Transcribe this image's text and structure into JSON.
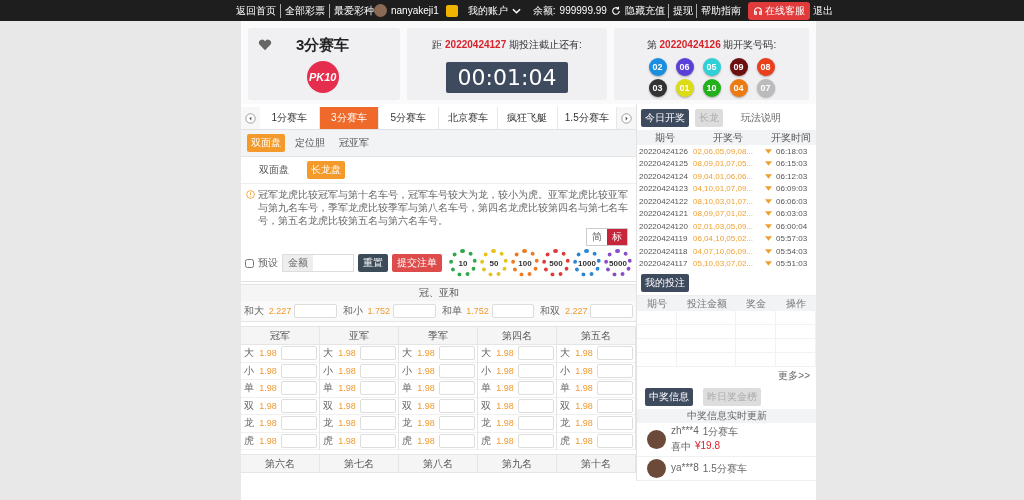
{
  "top_bar": {
    "links": [
      "返回首页",
      "全部彩票",
      "最爱彩种"
    ],
    "username": "nanyakeji1",
    "account_menu": "我的账户",
    "balance_label": "余额:",
    "balance": "999999.99",
    "hide": "隐藏",
    "actions": [
      "充值",
      "提现",
      "帮助指南"
    ],
    "service": "在线客服",
    "logout": "退出"
  },
  "game": {
    "title": "3分赛车",
    "logo_text": "PK10"
  },
  "countdown": {
    "prefix": "距",
    "issue": "20220424127",
    "suffix": "期投注截止还有:",
    "time": "00:01:04"
  },
  "last_draw": {
    "prefix": "第",
    "issue": "20220424126",
    "suffix": "期开奖号码:",
    "balls": [
      {
        "number": "02",
        "color": "#1a8fe0"
      },
      {
        "number": "06",
        "color": "#5b3fd9"
      },
      {
        "number": "05",
        "color": "#30d0d6"
      },
      {
        "number": "09",
        "color": "#6b0f0f"
      },
      {
        "number": "08",
        "color": "#e8401c"
      },
      {
        "number": "03",
        "color": "#333333"
      },
      {
        "number": "01",
        "color": "#dcdc14"
      },
      {
        "number": "10",
        "color": "#22b01c"
      },
      {
        "number": "04",
        "color": "#ee7a12"
      },
      {
        "number": "07",
        "color": "#bbbbbb"
      }
    ]
  },
  "game_tabs": [
    {
      "label": "1分赛车",
      "selected": false
    },
    {
      "label": "3分赛车",
      "selected": true
    },
    {
      "label": "5分赛车",
      "selected": false
    },
    {
      "label": "北京赛车",
      "selected": false
    },
    {
      "label": "疯狂飞艇",
      "selected": false
    },
    {
      "label": "1.5分赛车",
      "selected": false
    }
  ],
  "play_tabs": [
    {
      "label": "双面盘",
      "selected": true
    },
    {
      "label": "定位胆",
      "selected": false
    },
    {
      "label": "冠亚军",
      "selected": false
    }
  ],
  "mode_tabs": [
    {
      "label": "双面盘",
      "selected": false
    },
    {
      "label": "长龙盘",
      "selected": true
    }
  ],
  "notice": "冠军龙虎比较冠军与第十名车号，冠军车号较大为龙，较小为虎。亚军龙虎比较亚军与第九名车号，季军龙虎比较季军与第八名车号，第四名龙虎比较第四名与第七名车号，第五名龙虎比较第五名与第六名车号。",
  "view_toggle": [
    {
      "label": "简",
      "selected": false
    },
    {
      "label": "标",
      "selected": true
    }
  ],
  "bet_bar": {
    "preset_label": "预设",
    "preset_checked": false,
    "amount_label": "金额",
    "reset": "重置",
    "submit": "提交注单",
    "chips": [
      {
        "value": "10",
        "color": "#2ea84a"
      },
      {
        "value": "50",
        "color": "#e6c21a"
      },
      {
        "value": "100",
        "color": "#ee7a22"
      },
      {
        "value": "500",
        "color": "#e23a3a"
      },
      {
        "value": "1000",
        "color": "#2b86d6"
      },
      {
        "value": "5000",
        "color": "#8a4cc9"
      }
    ]
  },
  "sum_section": {
    "title": "冠、亚和",
    "options": [
      {
        "label": "和大",
        "odds": "2.227"
      },
      {
        "label": "和小",
        "odds": "1.752"
      },
      {
        "label": "和单",
        "odds": "1.752"
      },
      {
        "label": "和双",
        "odds": "2.227"
      }
    ]
  },
  "positions": [
    {
      "title": "冠军",
      "options": [
        {
          "label": "大",
          "odds": "1.98"
        },
        {
          "label": "小",
          "odds": "1.98"
        },
        {
          "label": "单",
          "odds": "1.98"
        },
        {
          "label": "双",
          "odds": "1.98"
        },
        {
          "label": "龙",
          "odds": "1.98"
        },
        {
          "label": "虎",
          "odds": "1.98"
        }
      ]
    },
    {
      "title": "亚军",
      "options": [
        {
          "label": "大",
          "odds": "1.98"
        },
        {
          "label": "小",
          "odds": "1.98"
        },
        {
          "label": "单",
          "odds": "1.98"
        },
        {
          "label": "双",
          "odds": "1.98"
        },
        {
          "label": "龙",
          "odds": "1.98"
        },
        {
          "label": "虎",
          "odds": "1.98"
        }
      ]
    },
    {
      "title": "季军",
      "options": [
        {
          "label": "大",
          "odds": "1.98"
        },
        {
          "label": "小",
          "odds": "1.98"
        },
        {
          "label": "单",
          "odds": "1.98"
        },
        {
          "label": "双",
          "odds": "1.98"
        },
        {
          "label": "龙",
          "odds": "1.98"
        },
        {
          "label": "虎",
          "odds": "1.98"
        }
      ]
    },
    {
      "title": "第四名",
      "options": [
        {
          "label": "大",
          "odds": "1.98"
        },
        {
          "label": "小",
          "odds": "1.98"
        },
        {
          "label": "单",
          "odds": "1.98"
        },
        {
          "label": "双",
          "odds": "1.98"
        },
        {
          "label": "龙",
          "odds": "1.98"
        },
        {
          "label": "虎",
          "odds": "1.98"
        }
      ]
    },
    {
      "title": "第五名",
      "options": [
        {
          "label": "大",
          "odds": "1.98"
        },
        {
          "label": "小",
          "odds": "1.98"
        },
        {
          "label": "单",
          "odds": "1.98"
        },
        {
          "label": "双",
          "odds": "1.98"
        },
        {
          "label": "龙",
          "odds": "1.98"
        },
        {
          "label": "虎",
          "odds": "1.98"
        }
      ]
    }
  ],
  "more_positions": [
    "第六名",
    "第七名",
    "第八名",
    "第九名",
    "第十名"
  ],
  "right_panel": {
    "tabs": [
      {
        "label": "今日开奖",
        "selected": true
      },
      {
        "label": "长龙",
        "selected": false
      }
    ],
    "rules_link": "玩法说明",
    "draw_columns": [
      "期号",
      "开奖号",
      "开奖时间"
    ],
    "draws": [
      {
        "issue": "20220424126",
        "numbers": "02,06,05,09,08...",
        "time": "06:18:03"
      },
      {
        "issue": "20220424125",
        "numbers": "08,09,01,07,05...",
        "time": "06:15:03"
      },
      {
        "issue": "20220424124",
        "numbers": "09,04,01,06,06...",
        "time": "06:12:03"
      },
      {
        "issue": "20220424123",
        "numbers": "04,10,01,07,09...",
        "time": "06:09:03"
      },
      {
        "issue": "20220424122",
        "numbers": "08,10,03,01,07...",
        "time": "06:06:03"
      },
      {
        "issue": "20220424121",
        "numbers": "08,09,07,01,02...",
        "time": "06:03:03"
      },
      {
        "issue": "20220424120",
        "numbers": "02,01,03,05,09...",
        "time": "06:00:04"
      },
      {
        "issue": "20220424119",
        "numbers": "06,04,10,05,02...",
        "time": "05:57:03"
      },
      {
        "issue": "20220424118",
        "numbers": "04,07,10,06,09...",
        "time": "05:54:03"
      },
      {
        "issue": "20220424117",
        "numbers": "05,10,03,07,02...",
        "time": "05:51:03"
      }
    ],
    "my_bets_button": "我的投注",
    "bet_columns": [
      "期号",
      "投注金额",
      "奖金",
      "操作"
    ],
    "more": "更多>>",
    "info_tabs": [
      {
        "label": "中奖信息",
        "selected": true
      },
      {
        "label": "昨日奖金榜",
        "selected": false
      }
    ],
    "feed_title": "中奖信息实时更新",
    "winners": [
      {
        "user": "zh***4",
        "game": "1分赛车",
        "prize_label": "喜中",
        "prize": "¥19.8"
      },
      {
        "user": "ya***8",
        "game": "1.5分赛车"
      }
    ]
  }
}
